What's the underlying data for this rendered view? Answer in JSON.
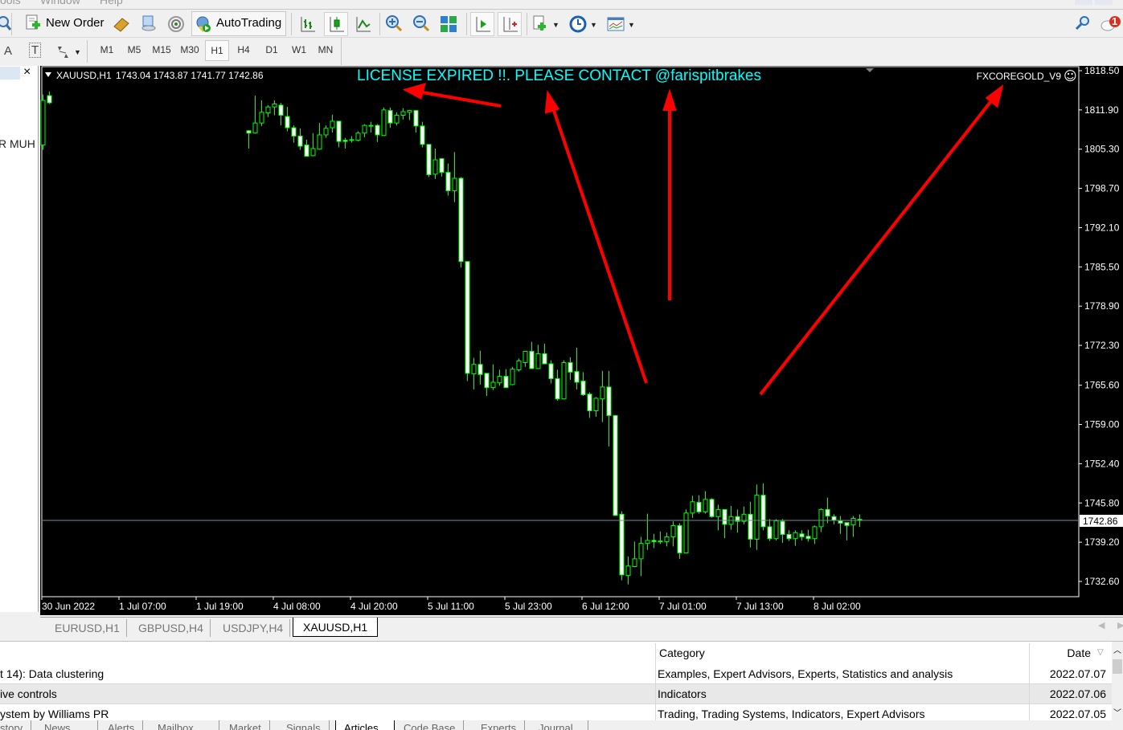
{
  "menu": {
    "items": [
      "ools",
      "Window",
      "Help"
    ]
  },
  "window_controls": {
    "minimize": "–",
    "maximize": "□"
  },
  "toolbar": {
    "new_order_label": "New Order",
    "autotrading_label": "AutoTrading",
    "notification_count": "1",
    "text_tool_label": "A",
    "textlabel_tool_label": "T"
  },
  "timeframes": {
    "items": [
      "M1",
      "M5",
      "M15",
      "M30",
      "H1",
      "H4",
      "D1",
      "W1",
      "MN"
    ],
    "active": "H1"
  },
  "navigator": {
    "close": "×",
    "visible_text": "R MUH"
  },
  "chart": {
    "symbol": "XAUUSD,H1",
    "ohlc": "1743.04 1743.87 1741.77 1742.86",
    "license_message": "LICENSE EXPIRED !!. PLEASE CONTACT @farispitbrakes",
    "ea_name": "FXCOREGOLD_V9",
    "ea_smiley": "☺",
    "bid_label": "1742.86",
    "colors": {
      "background": "#000000",
      "candle_outline": "#00ff00",
      "bear_fill": "#ffffff",
      "bull_fill": "#000000",
      "bid_line": "#778899",
      "license_text": "#00ffff",
      "arrow": "#ff0000"
    }
  },
  "chart_data": {
    "type": "candlestick",
    "title": "XAUUSD,H1",
    "ylim": [
      1732.6,
      1818.5
    ],
    "y_ticks": [
      "1818.50",
      "1811.90",
      "1805.30",
      "1798.70",
      "1792.10",
      "1785.50",
      "1778.90",
      "1772.30",
      "1765.60",
      "1759.00",
      "1752.40",
      "1745.80",
      "1739.20",
      "1732.60"
    ],
    "x_tick_labels": [
      "30 Jun 2022",
      "1 Jul 07:00",
      "1 Jul 19:00",
      "4 Jul 08:00",
      "4 Jul 20:00",
      "5 Jul 11:00",
      "5 Jul 23:00",
      "6 Jul 12:00",
      "7 Jul 01:00",
      "7 Jul 13:00",
      "8 Jul 02:00"
    ],
    "bars_per_x_tick": 12,
    "bid": 1742.86,
    "ohlc_order": [
      "open",
      "high",
      "low",
      "close"
    ],
    "leading_bars": [
      [
        1806.0,
        1814.5,
        1805.2,
        1813.5
      ],
      [
        1814.3,
        1815.0,
        1812.9,
        1813.1
      ]
    ],
    "gap_bars": 30,
    "bars": [
      [
        1808.4,
        1808.5,
        1805.4,
        1808.0
      ],
      [
        1808.0,
        1814.3,
        1807.9,
        1809.7
      ],
      [
        1809.7,
        1813.5,
        1809.2,
        1811.5
      ],
      [
        1811.4,
        1812.7,
        1810.7,
        1812.4
      ],
      [
        1812.4,
        1813.5,
        1811.0,
        1812.9
      ],
      [
        1812.7,
        1813.1,
        1809.3,
        1811.0
      ],
      [
        1810.8,
        1812.4,
        1808.3,
        1808.9
      ],
      [
        1808.9,
        1809.3,
        1806.4,
        1807.5
      ],
      [
        1807.5,
        1808.8,
        1805.2,
        1805.8
      ],
      [
        1806.0,
        1806.9,
        1804.1,
        1804.1
      ],
      [
        1804.2,
        1808.0,
        1804.1,
        1805.4
      ],
      [
        1805.3,
        1809.7,
        1805.2,
        1807.7
      ],
      [
        1807.7,
        1809.3,
        1807.2,
        1808.8
      ],
      [
        1808.9,
        1811.1,
        1808.1,
        1810.0
      ],
      [
        1810.0,
        1810.0,
        1805.6,
        1806.6
      ],
      [
        1806.8,
        1807.2,
        1805.4,
        1806.6
      ],
      [
        1806.8,
        1807.5,
        1806.4,
        1806.9
      ],
      [
        1806.8,
        1808.3,
        1806.6,
        1808.0
      ],
      [
        1808.0,
        1809.5,
        1807.3,
        1809.3
      ],
      [
        1809.2,
        1809.9,
        1808.1,
        1809.3
      ],
      [
        1809.3,
        1809.5,
        1806.5,
        1807.7
      ],
      [
        1807.6,
        1812.3,
        1807.5,
        1811.9
      ],
      [
        1811.8,
        1812.3,
        1808.9,
        1809.7
      ],
      [
        1809.7,
        1811.5,
        1809.3,
        1811.0
      ],
      [
        1811.0,
        1812.2,
        1810.3,
        1811.6
      ],
      [
        1811.5,
        1811.9,
        1810.2,
        1811.8
      ],
      [
        1811.8,
        1811.8,
        1808.1,
        1809.2
      ],
      [
        1809.2,
        1809.9,
        1805.6,
        1806.1
      ],
      [
        1806.1,
        1806.1,
        1800.6,
        1801.0
      ],
      [
        1801.1,
        1805.4,
        1800.3,
        1803.5
      ],
      [
        1803.7,
        1803.8,
        1800.7,
        1801.4
      ],
      [
        1801.4,
        1802.9,
        1797.5,
        1798.3
      ],
      [
        1798.3,
        1804.8,
        1796.4,
        1800.4
      ],
      [
        1800.4,
        1800.6,
        1785.4,
        1786.4
      ],
      [
        1786.4,
        1786.4,
        1766.3,
        1767.6
      ],
      [
        1767.5,
        1770.2,
        1764.9,
        1769.1
      ],
      [
        1769.1,
        1771.4,
        1765.7,
        1767.4
      ],
      [
        1767.6,
        1767.6,
        1763.8,
        1765.2
      ],
      [
        1765.2,
        1769.1,
        1764.8,
        1766.1
      ],
      [
        1766.0,
        1768.2,
        1765.5,
        1767.1
      ],
      [
        1767.1,
        1768.3,
        1765.2,
        1765.2
      ],
      [
        1765.7,
        1768.7,
        1765.6,
        1768.3
      ],
      [
        1768.2,
        1770.1,
        1767.9,
        1769.7
      ],
      [
        1769.4,
        1771.3,
        1768.7,
        1771.3
      ],
      [
        1771.3,
        1772.9,
        1768.3,
        1768.4
      ],
      [
        1768.4,
        1772.4,
        1768.3,
        1770.9
      ],
      [
        1770.9,
        1772.6,
        1769.2,
        1769.2
      ],
      [
        1769.2,
        1769.8,
        1765.9,
        1766.7
      ],
      [
        1766.7,
        1768.2,
        1763.0,
        1763.3
      ],
      [
        1763.3,
        1769.8,
        1763.2,
        1769.4
      ],
      [
        1769.4,
        1770.3,
        1766.5,
        1767.8
      ],
      [
        1767.9,
        1771.9,
        1764.9,
        1766.1
      ],
      [
        1766.3,
        1767.8,
        1763.8,
        1764.0
      ],
      [
        1764.1,
        1764.4,
        1760.1,
        1761.3
      ],
      [
        1761.3,
        1763.6,
        1760.3,
        1763.4
      ],
      [
        1763.3,
        1768.0,
        1759.4,
        1765.3
      ],
      [
        1765.3,
        1768.0,
        1755.3,
        1760.5
      ],
      [
        1760.5,
        1760.6,
        1743.6,
        1743.7
      ],
      [
        1743.9,
        1744.4,
        1732.8,
        1733.7
      ],
      [
        1733.6,
        1736.8,
        1732.1,
        1735.2
      ],
      [
        1735.1,
        1739.3,
        1735.0,
        1736.4
      ],
      [
        1736.4,
        1740.1,
        1733.5,
        1739.0
      ],
      [
        1739.0,
        1744.0,
        1737.9,
        1739.5
      ],
      [
        1739.5,
        1740.6,
        1738.2,
        1739.3
      ],
      [
        1739.4,
        1741.0,
        1738.9,
        1739.3
      ],
      [
        1739.3,
        1740.8,
        1738.5,
        1740.1
      ],
      [
        1740.1,
        1742.7,
        1738.5,
        1742.0
      ],
      [
        1742.0,
        1742.4,
        1736.4,
        1737.4
      ],
      [
        1737.4,
        1744.7,
        1737.4,
        1744.1
      ],
      [
        1744.1,
        1747.0,
        1743.3,
        1746.0
      ],
      [
        1745.9,
        1747.1,
        1744.0,
        1744.3
      ],
      [
        1744.3,
        1747.8,
        1744.0,
        1746.4
      ],
      [
        1746.4,
        1746.6,
        1743.3,
        1743.5
      ],
      [
        1743.5,
        1745.5,
        1741.2,
        1744.7
      ],
      [
        1744.7,
        1744.7,
        1739.9,
        1742.2
      ],
      [
        1742.2,
        1745.3,
        1741.3,
        1743.5
      ],
      [
        1743.5,
        1744.7,
        1740.8,
        1742.7
      ],
      [
        1742.7,
        1745.2,
        1742.2,
        1743.9
      ],
      [
        1743.9,
        1746.0,
        1738.3,
        1739.7
      ],
      [
        1739.7,
        1748.9,
        1737.9,
        1747.1
      ],
      [
        1747.1,
        1749.1,
        1741.2,
        1741.8
      ],
      [
        1741.8,
        1743.1,
        1739.4,
        1739.8
      ],
      [
        1739.8,
        1743.1,
        1739.5,
        1742.8
      ],
      [
        1742.7,
        1743.1,
        1739.1,
        1740.5
      ],
      [
        1740.5,
        1741.2,
        1739.4,
        1739.8
      ],
      [
        1739.8,
        1741.2,
        1738.6,
        1740.8
      ],
      [
        1740.6,
        1741.2,
        1739.5,
        1740.1
      ],
      [
        1740.2,
        1741.3,
        1739.3,
        1739.8
      ],
      [
        1739.8,
        1742.0,
        1738.9,
        1741.8
      ],
      [
        1741.8,
        1744.9,
        1740.9,
        1744.7
      ],
      [
        1744.7,
        1746.7,
        1742.4,
        1743.6
      ],
      [
        1743.5,
        1743.9,
        1742.2,
        1742.9
      ],
      [
        1742.8,
        1743.6,
        1740.6,
        1742.4
      ],
      [
        1742.5,
        1742.5,
        1739.5,
        1742.0
      ],
      [
        1742.1,
        1743.6,
        1740.1,
        1743.2
      ],
      [
        1743.04,
        1743.87,
        1741.77,
        1742.86
      ]
    ]
  },
  "symbol_tabs": [
    {
      "label": "EURUSD,H1",
      "active": false
    },
    {
      "label": "GBPUSD,H4",
      "active": false
    },
    {
      "label": "USDJPY,H4",
      "active": false
    },
    {
      "label": "XAUUSD,H1",
      "active": true
    }
  ],
  "articles": {
    "columns": [
      "Category",
      "Date"
    ],
    "rows": [
      {
        "title": "t 14): Data clustering",
        "category": "Examples, Expert Advisors, Experts, Statistics and analysis",
        "date": "2022.07.07"
      },
      {
        "title": "ive controls",
        "category": "Indicators",
        "date": "2022.07.06"
      },
      {
        "title": "ystem by Williams PR",
        "category": "Trading, Trading Systems, Indicators, Expert Advisors",
        "date": "2022.07.05"
      }
    ]
  },
  "terminal_tabs": [
    {
      "label": "story",
      "active": false
    },
    {
      "label": "News",
      "active": false
    },
    {
      "label": "Alerts",
      "active": false
    },
    {
      "label": "Mailbox",
      "active": false
    },
    {
      "label": "Market",
      "active": false
    },
    {
      "label": "Signals",
      "active": false
    },
    {
      "label": "Articles",
      "active": true
    },
    {
      "label": "Code Base",
      "active": false
    },
    {
      "label": "Experts",
      "active": false
    },
    {
      "label": "Journal",
      "active": false
    }
  ]
}
